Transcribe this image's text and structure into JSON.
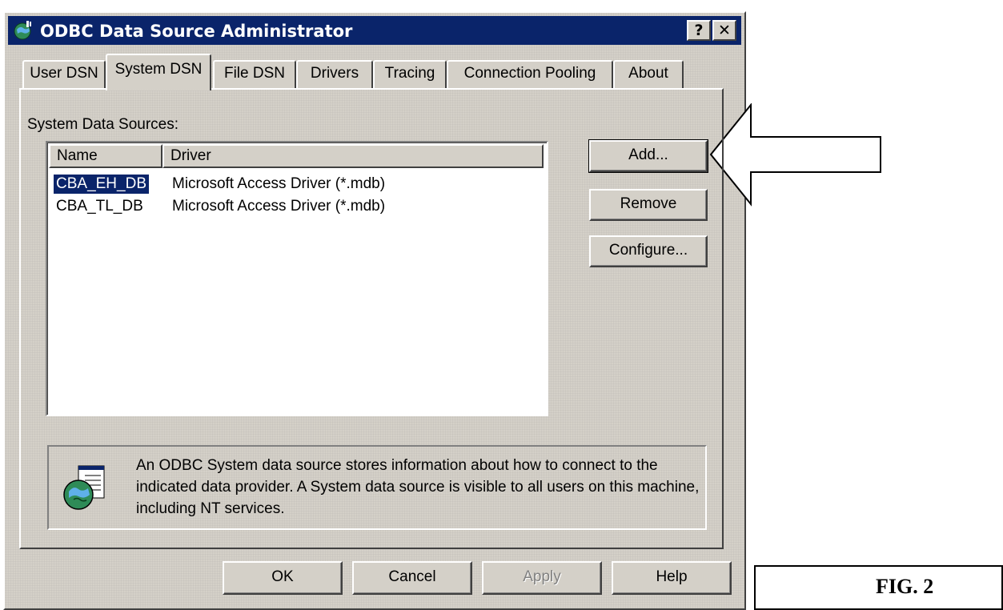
{
  "window": {
    "title": "ODBC Data Source Administrator",
    "help_button": "?",
    "close_button": "✕"
  },
  "tabs": [
    {
      "label": "User DSN",
      "active": false
    },
    {
      "label": "System DSN",
      "active": true
    },
    {
      "label": "File DSN",
      "active": false
    },
    {
      "label": "Drivers",
      "active": false
    },
    {
      "label": "Tracing",
      "active": false
    },
    {
      "label": "Connection Pooling",
      "active": false
    },
    {
      "label": "About",
      "active": false
    }
  ],
  "system_data_sources": {
    "label": "System Data Sources:",
    "columns": [
      "Name",
      "Driver"
    ],
    "rows": [
      {
        "name": "CBA_EH_DB",
        "driver": "Microsoft Access Driver (*.mdb)",
        "selected": true
      },
      {
        "name": "CBA_TL_DB",
        "driver": "Microsoft Access Driver (*.mdb)",
        "selected": false
      }
    ]
  },
  "side_buttons": {
    "add": "Add...",
    "remove": "Remove",
    "configure": "Configure..."
  },
  "info": {
    "text": "An ODBC System data source stores information about how to connect to the indicated data provider.  A System data source is visible to all users on this machine, including NT services."
  },
  "footer_buttons": {
    "ok": "OK",
    "cancel": "Cancel",
    "apply": "Apply",
    "help": "Help"
  },
  "annotation": {
    "figure_label": "FIG. 2"
  },
  "colors": {
    "titlebar": "#0a246a",
    "dialog_face": "#d4d0c8",
    "selection": "#0a246a"
  }
}
